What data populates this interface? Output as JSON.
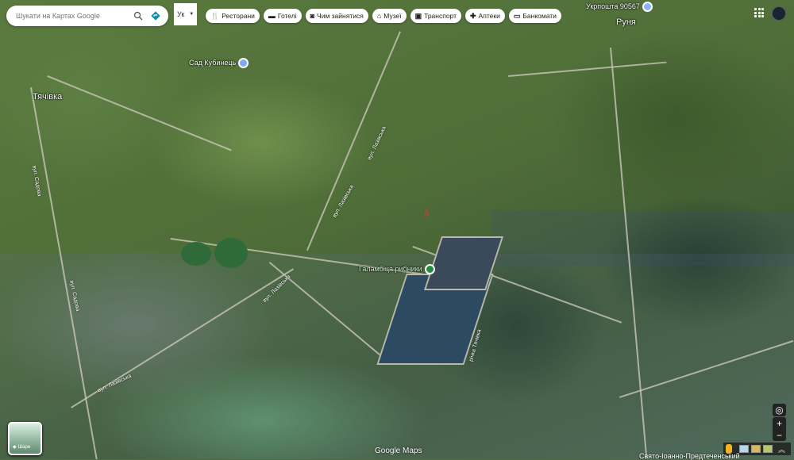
{
  "search": {
    "placeholder": "Шукати на Картах Google"
  },
  "language": {
    "value": "Ук"
  },
  "chips": [
    {
      "icon": "restaurant-icon",
      "glyph": "🍴",
      "label": "Ресторани"
    },
    {
      "icon": "hotel-icon",
      "glyph": "▬",
      "label": "Готелі"
    },
    {
      "icon": "camera-icon",
      "glyph": "◙",
      "label": "Чим зайнятися"
    },
    {
      "icon": "museum-icon",
      "glyph": "⌂",
      "label": "Музеї"
    },
    {
      "icon": "transit-icon",
      "glyph": "▣",
      "label": "Транспорт"
    },
    {
      "icon": "pharmacy-icon",
      "glyph": "✚",
      "label": "Аптеки"
    },
    {
      "icon": "atm-icon",
      "glyph": "▭",
      "label": "Банкомати"
    }
  ],
  "map_labels": {
    "village_tyachivka": "Тячівка",
    "village_runya": "Руня",
    "garden": "Сад Кубинець",
    "post": "Укрпошта 90567",
    "fish_farm": "Галамбіца рибники",
    "monastery": "Свято-Іоанно-Предтеченський",
    "street_sadova": "вул. Садова",
    "street_lazivska": "вул. Лазівська",
    "river": "річка Тячівка"
  },
  "layers": {
    "label": "Шари"
  },
  "attribution": "Google Maps",
  "colors": {
    "pin_blue": "#7baaf7",
    "pin_green": "#1e8e3e",
    "post_pin": "#8ab4f8"
  }
}
